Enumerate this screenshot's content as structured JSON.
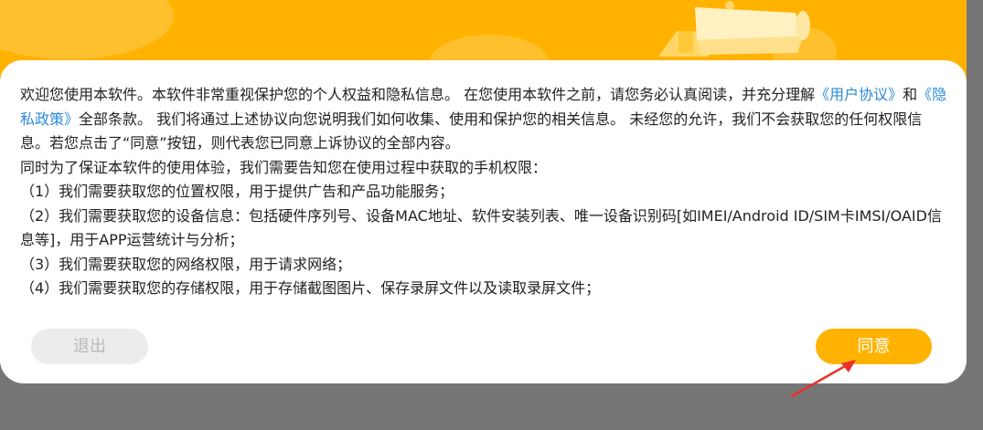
{
  "dialog": {
    "paragraph1_a": "欢迎您使用本软件。本软件非常重视保护您的个人权益和隐私信息。 在您使用本软件之前，请您务必认真阅读，并充分理解",
    "user_agreement_link": "《用户协议》",
    "and": "和",
    "privacy_policy_link": "《隐私政策》",
    "paragraph1_b": "全部条款。 我们将通过上述协议向您说明我们如何收集、使用和保护您的相关信息。 未经您的允许，我们不会获取您的任何权限信息。若您点击了“同意”按钮，则代表您已同意上诉协议的全部内容。",
    "paragraph2": " 同时为了保证本软件的使用体验，我们需要告知您在使用过程中获取的手机权限：",
    "permissions": [
      "（1）我们需要获取您的位置权限，用于提供广告和产品功能服务；",
      "（2）我们需要获取您的设备信息：包括硬件序列号、设备MAC地址、软件安装列表、唯一设备识别码[如IMEI/Android ID/SIM卡IMSI/OAID信息等]，用于APP运营统计与分析；",
      "（3）我们需要获取您的网络权限，用于请求网络；",
      "（4）我们需要获取您的存储权限，用于存储截图图片、保存录屏文件以及读取录屏文件；"
    ],
    "exit_label": "退出",
    "agree_label": "同意"
  },
  "colors": {
    "banner": "#ffb300",
    "link": "#2a8ad8",
    "agree_button": "#ffb300",
    "exit_button": "#ececec",
    "overlay": "#767676",
    "annotation_arrow": "#e8322b"
  },
  "icons": {
    "banner_illustration": "megaphone-icon",
    "annotation": "red-arrow-icon"
  }
}
